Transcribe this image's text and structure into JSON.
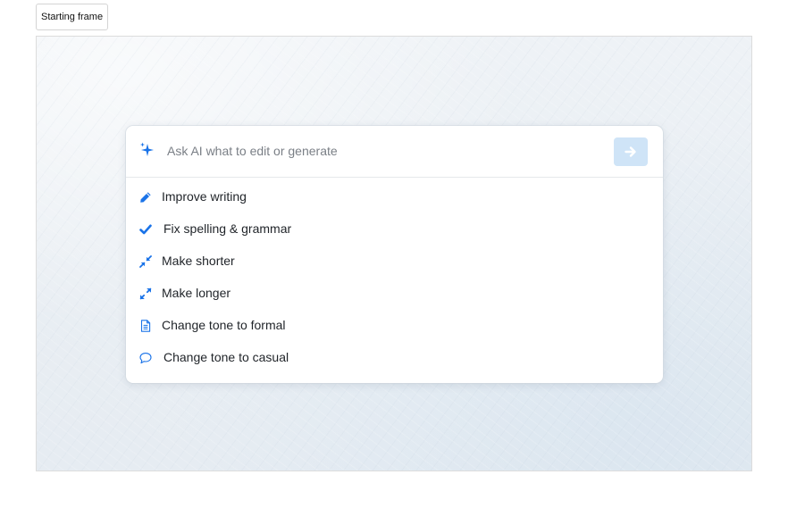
{
  "frame_tag": {
    "label": "Starting frame"
  },
  "prompt": {
    "placeholder": "Ask AI what to edit or generate",
    "value": "",
    "leading_icon": "sparkle-icon",
    "send_icon": "arrow-right-icon"
  },
  "menu": {
    "items": [
      {
        "label": "Improve writing",
        "icon": "pencil-icon"
      },
      {
        "label": "Fix spelling & grammar",
        "icon": "check-icon"
      },
      {
        "label": "Make shorter",
        "icon": "compress-icon"
      },
      {
        "label": "Make longer",
        "icon": "expand-icon"
      },
      {
        "label": "Change tone to formal",
        "icon": "document-icon"
      },
      {
        "label": "Change tone to casual",
        "icon": "speech-bubble-icon"
      }
    ]
  },
  "colors": {
    "accent": "#1a73e8",
    "send_button_bg": "#cfe4f7",
    "placeholder_text": "#7a7f86",
    "item_text": "#1f2328"
  }
}
